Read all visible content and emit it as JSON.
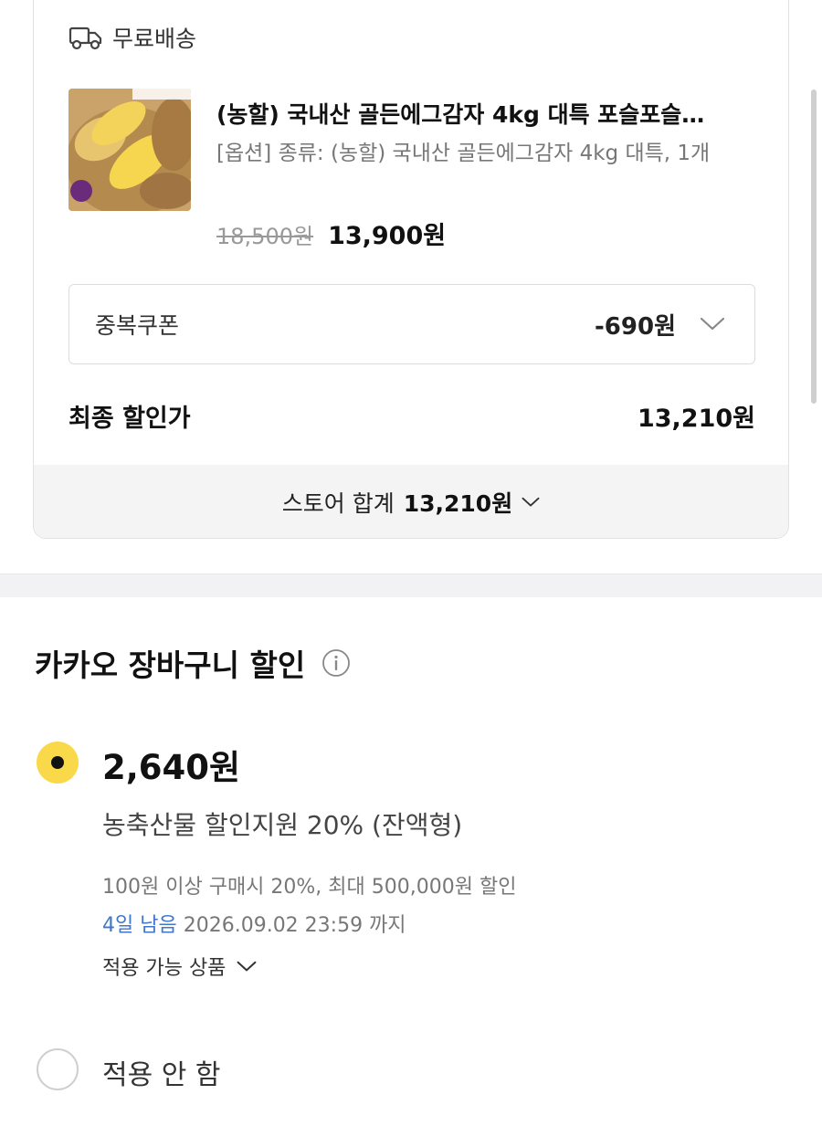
{
  "store": {
    "shipping_icon": "truck-icon",
    "shipping_label": "무료배송",
    "product": {
      "image_icon": "potato-product-image",
      "title": "(농할) 국내산 골든에그감자 4kg 대특 포슬포슬…",
      "option": "[옵션] 종류: (농할) 국내산 골든에그감자 4kg 대특, 1개",
      "original_price": "18,500원",
      "sale_price": "13,900원"
    },
    "coupon": {
      "label": "중복쿠폰",
      "value": "-690원"
    },
    "final": {
      "label": "최종 할인가",
      "value": "13,210원"
    },
    "total": {
      "label": "스토어 합계",
      "value": "13,210원"
    }
  },
  "kakao_discount": {
    "title": "카카오 장바구니 할인",
    "info_icon": "info-icon",
    "options": [
      {
        "selected": true,
        "amount": "2,640원",
        "name": "농축산물 할인지원 20% (잔액형)",
        "condition": "100원 이상 구매시 20%, 최대 500,000원 할인",
        "remaining": "4일 남음",
        "expiry": "2026.09.02 23:59 까지",
        "applicable_label": "적용 가능 상품"
      },
      {
        "selected": false,
        "label": "적용 안 함"
      }
    ]
  },
  "colors": {
    "accent_yellow": "#f9d94a",
    "link_blue": "#3f77c9",
    "section_gray": "#f2f2f4"
  }
}
